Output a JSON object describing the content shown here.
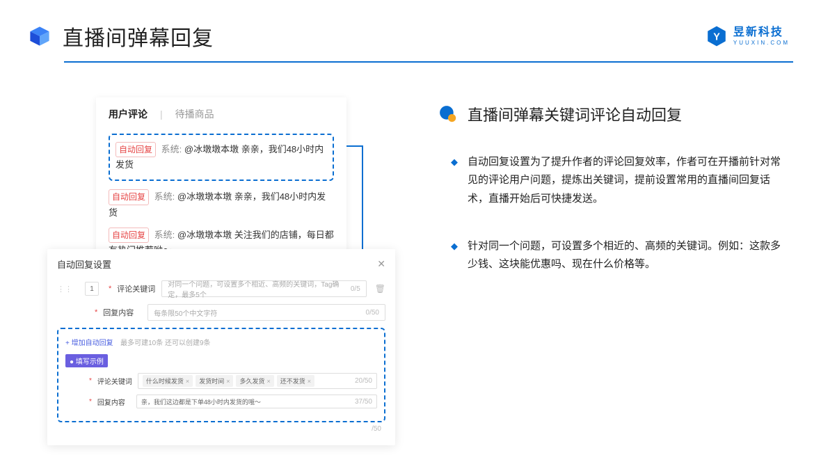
{
  "header": {
    "title": "直播间弹幕回复",
    "brand_name": "昱新科技",
    "brand_sub": "YUUXIN.COM"
  },
  "comments": {
    "tab_active": "用户评论",
    "tab_inactive": "待播商品",
    "auto_tag": "自动回复",
    "sys_label": "系统:",
    "line1": "@冰墩墩本墩 亲亲，我们48小时内发货",
    "line2": "@冰墩墩本墩 亲亲，我们48小时内发货",
    "line3": "@冰墩墩本墩 关注我们的店铺，每日都有热门推荐呦～"
  },
  "settings": {
    "title": "自动回复设置",
    "row_num": "1",
    "kw_label": "评论关键词",
    "kw_placeholder": "对同一个问题，可设置多个相近、高频的关键词，Tag确定，最多5个",
    "kw_counter": "0/5",
    "content_label": "回复内容",
    "content_placeholder": "每条限50个中文字符",
    "content_counter": "0/50",
    "add_link": "+ 增加自动回复",
    "add_note": "最多可建10条 还可以创建9条",
    "example_badge": "● 填写示例",
    "ex_kw_label": "评论关键词",
    "ex_tags": [
      "什么时候发货",
      "发货时间",
      "多久发货",
      "还不发货"
    ],
    "ex_kw_counter": "20/50",
    "ex_content_label": "回复内容",
    "ex_content_value": "亲，我们这边都是下单48小时内发货的哦～",
    "ex_content_counter": "37/50",
    "outer_counter": "/50"
  },
  "right": {
    "section_title": "直播间弹幕关键词评论自动回复",
    "bullet1": "自动回复设置为了提升作者的评论回复效率，作者可在开播前针对常见的评论用户问题，提炼出关键词，提前设置常用的直播间回复话术，直播开始后可快捷发送。",
    "bullet2": "针对同一个问题，可设置多个相近的、高频的关键词。例如：这款多少钱、这块能优惠吗、现在什么价格等。"
  }
}
